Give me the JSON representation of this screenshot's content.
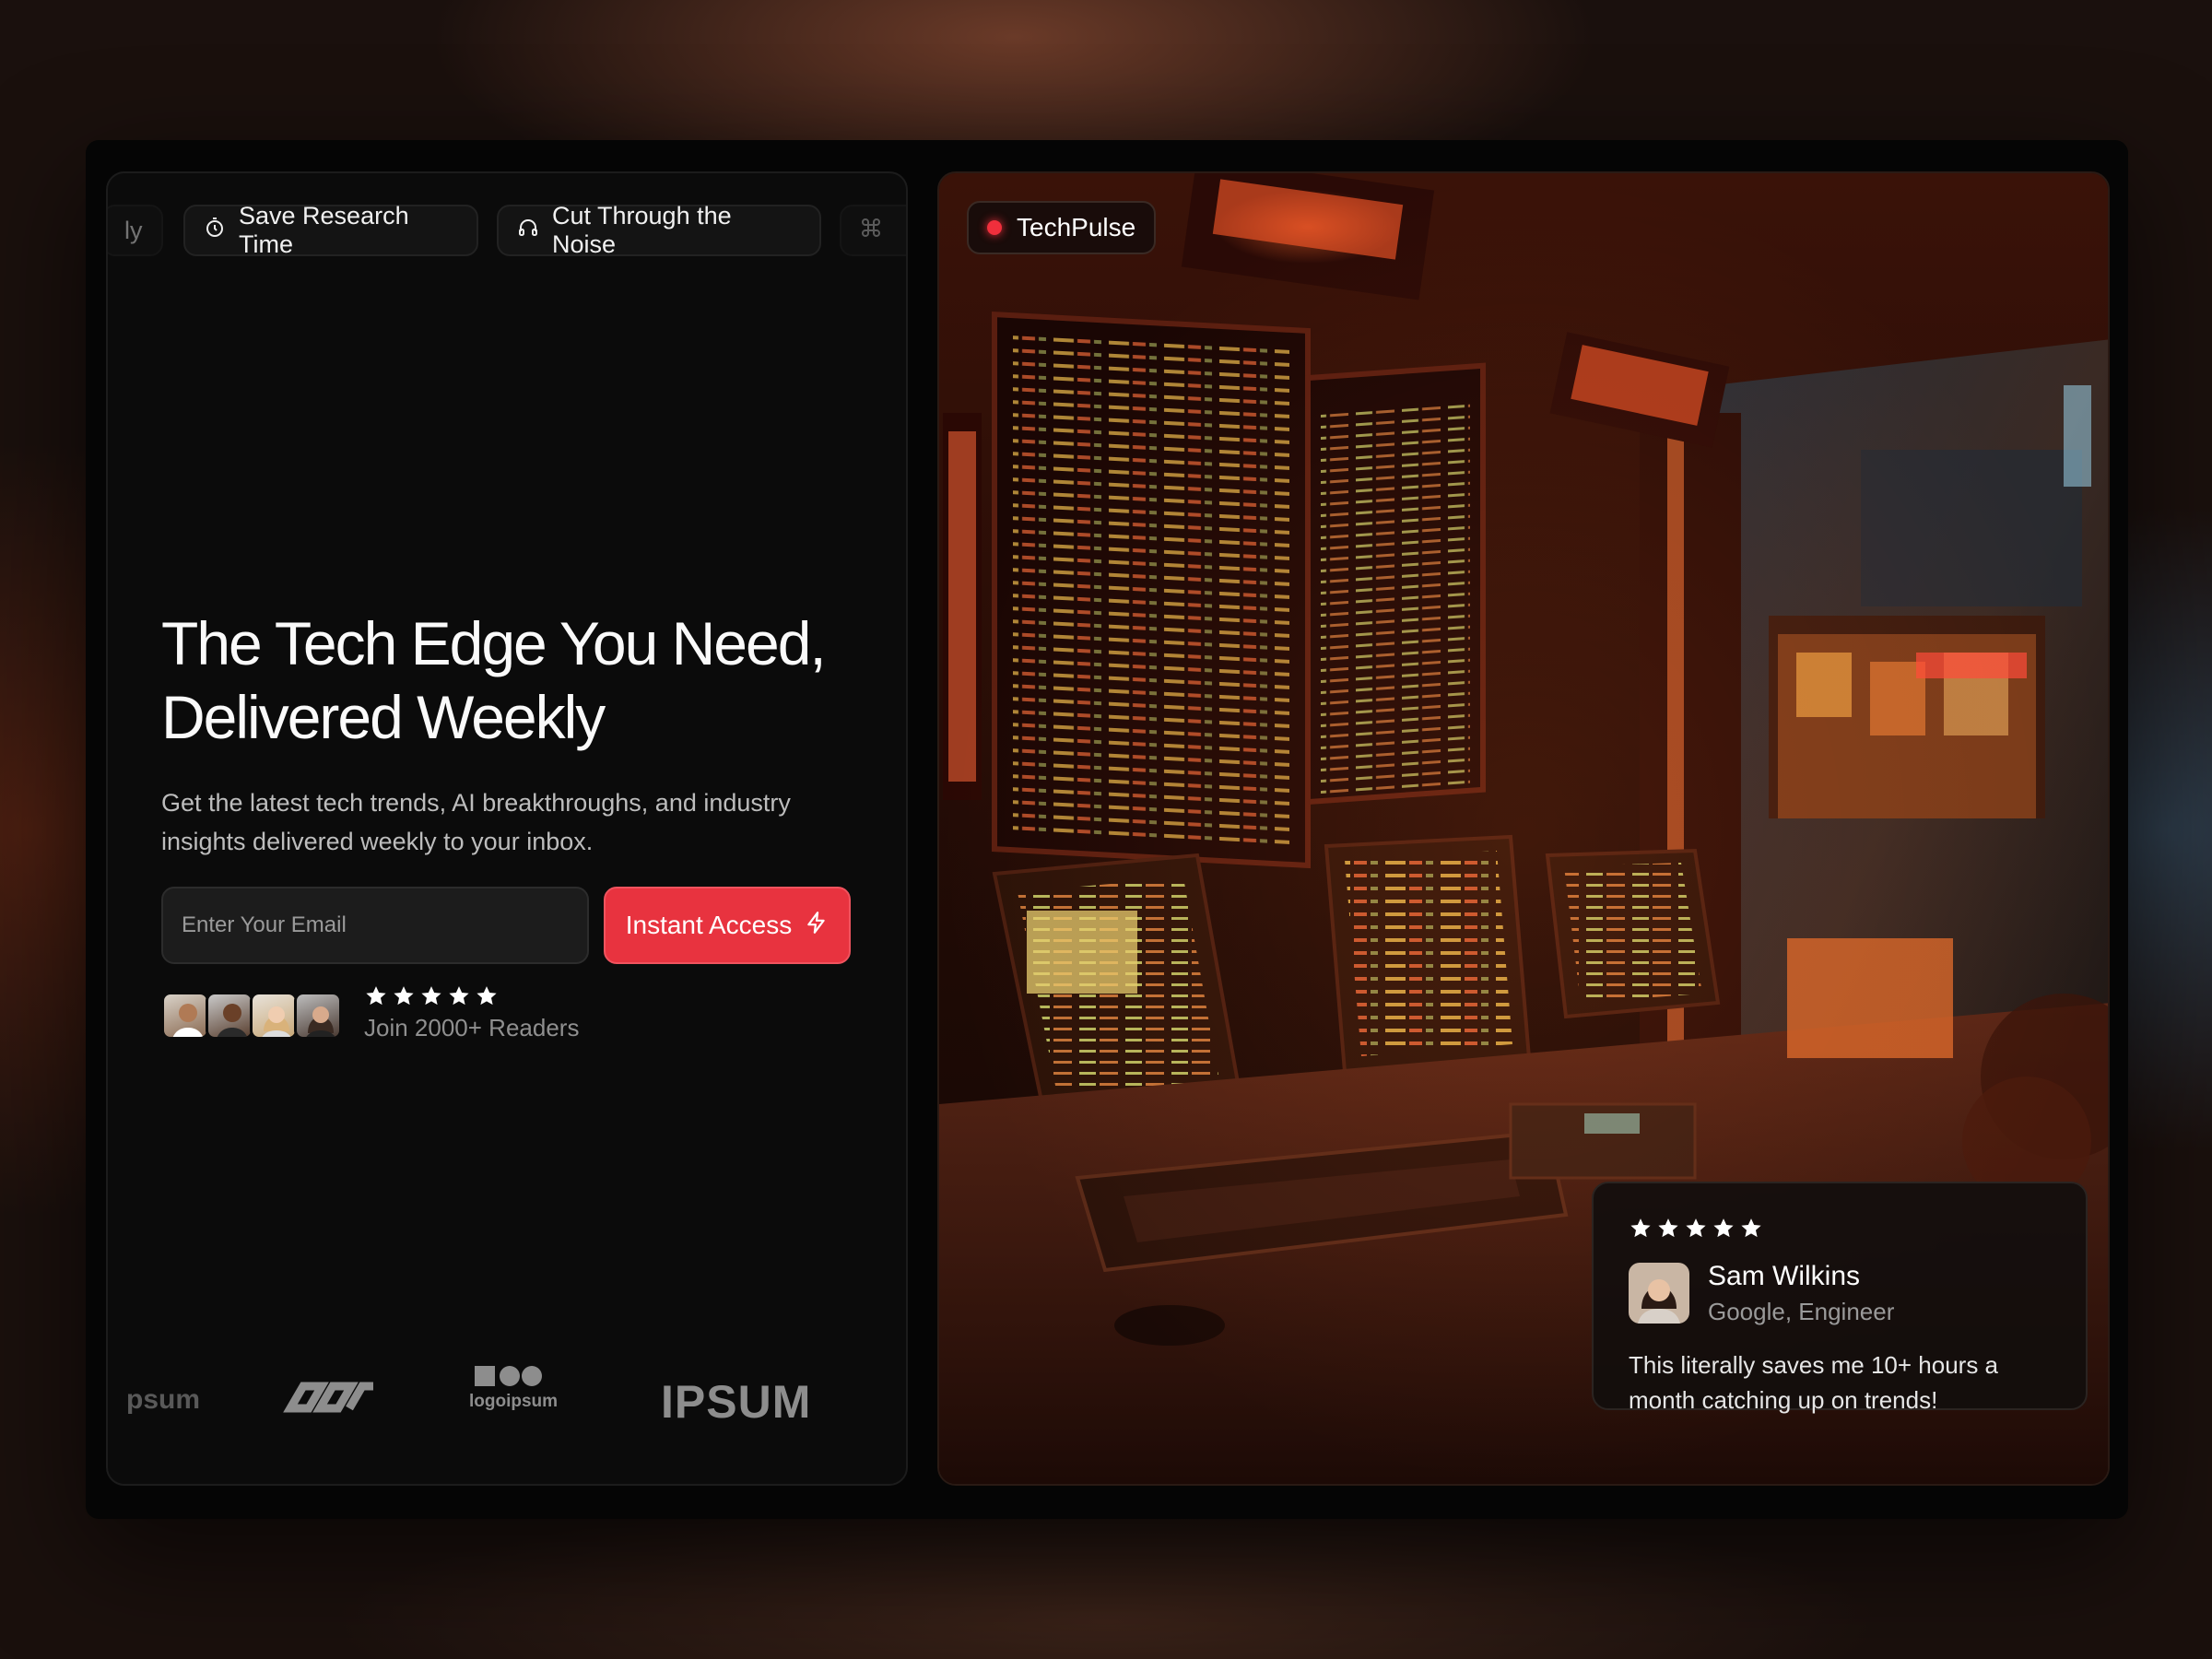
{
  "chips": {
    "partial_left_label": "ly",
    "save_research": "Save Research Time",
    "cut_noise": "Cut Through the Noise"
  },
  "hero": {
    "title_line1": "The Tech Edge You Need,",
    "title_line2": "Delivered Weekly",
    "subtitle_line1": "Get the latest tech trends, AI breakthroughs, and industry",
    "subtitle_line2": "insights delivered weekly to your inbox."
  },
  "form": {
    "email_placeholder": "Enter Your Email",
    "cta_label": "Instant Access"
  },
  "social_proof": {
    "rating": 5,
    "readers_label": "Join 2000+ Readers"
  },
  "logos": {
    "partial": "psum",
    "logoipsum": "logoipsum",
    "ipsum": "IPSUM"
  },
  "brand": {
    "name": "TechPulse",
    "dot_color": "#ef2f3c"
  },
  "review": {
    "rating": 5,
    "name": "Sam Wilkins",
    "role": "Google, Engineer",
    "quote_line1": "This literally saves me 10+ hours a",
    "quote_line2": "month catching up on trends!"
  },
  "colors": {
    "accent": "#e8333f",
    "panel_bg": "#0b0b0b"
  }
}
